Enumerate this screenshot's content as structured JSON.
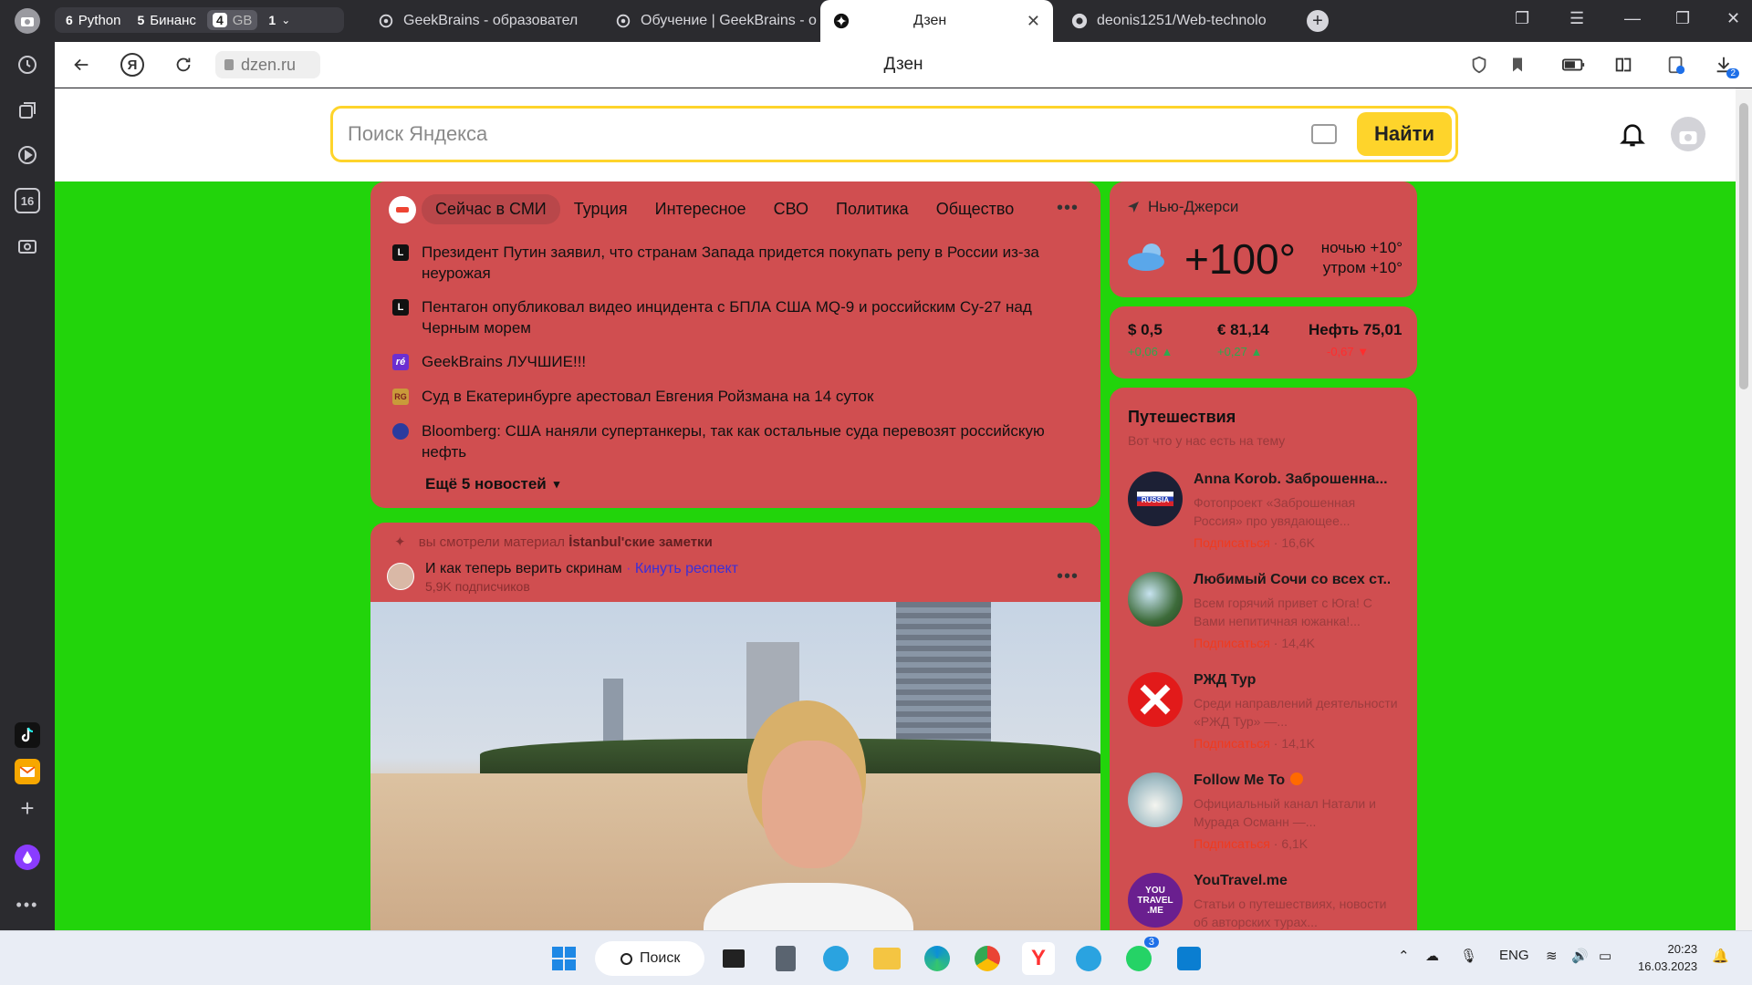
{
  "tabs": {
    "groups": [
      {
        "num": "6",
        "label": "Python"
      },
      {
        "num": "5",
        "label": "Бинанс"
      },
      {
        "num": "4",
        "label": "GB"
      },
      {
        "num": "1",
        "label": ""
      }
    ],
    "items": [
      {
        "title": "GeekBrains - образовател"
      },
      {
        "title": "Обучение | GeekBrains - о"
      },
      {
        "title": "Дзен"
      },
      {
        "title": "deonis1251/Web-technolo"
      }
    ]
  },
  "address": {
    "url": "dzen.ru",
    "page_title": "Дзен"
  },
  "toolbar": {
    "downloads_badge": "2"
  },
  "search": {
    "placeholder": "Поиск Яндекса",
    "button": "Найти"
  },
  "news": {
    "tabs": [
      "Сейчас в СМИ",
      "Турция",
      "Интересное",
      "СВО",
      "Политика",
      "Общество"
    ],
    "items": [
      {
        "src": "L",
        "text": "Президент Путин заявил, что странам Запада придется покупать репу в России из-за неурожая"
      },
      {
        "src": "L",
        "text": "Пентагон опубликовал видео инцидента с БПЛА США MQ-9 и российским Су-27 над Черным морем"
      },
      {
        "src": "ré",
        "text": "GeekBrains ЛУЧШИЕ!!!"
      },
      {
        "src": "RG",
        "text": "Суд в Екатеринбурге арестовал Евгения Ройзмана на 14 суток"
      },
      {
        "src": "",
        "text": "Bloomberg: США наняли супертанкеры, так как остальные суда перевозят российскую нефть"
      }
    ],
    "more": "Ещё 5 новостей"
  },
  "weather": {
    "city": "Нью-Джерси",
    "temp": "+100°",
    "night": "ночью +10°",
    "morning": "утром +10°"
  },
  "rates": [
    {
      "label": "$ 0,5",
      "delta": "+0,06 ▲"
    },
    {
      "label": "€ 81,14",
      "delta": "+0,27 ▲"
    },
    {
      "label": "Нефть 75,01",
      "delta": "-0,67 ▼"
    }
  ],
  "travel": {
    "title": "Путешествия",
    "subtitle": "Вот что у нас есть на тему",
    "subscribe": "Подписаться",
    "channels": [
      {
        "name": "Anna Korob. Заброшенна...",
        "desc": "Фотопроект «Заброшенная Россия» про увядающее...",
        "subs": "16,6K"
      },
      {
        "name": "Любимый Сочи со всех ст...",
        "desc": "Всем горячий привет с Юга! С Вами непитичная южанка!...",
        "subs": "14,4K"
      },
      {
        "name": "РЖД Тур",
        "desc": "Среди направлений деятельности «РЖД Тур» —...",
        "subs": "14,1K"
      },
      {
        "name": "Follow Me To",
        "desc": "Официальный канал Натали и Мурада Османн —...",
        "subs": "6,1K"
      },
      {
        "name": "YouTravel.me",
        "desc": "Статьи о путешествиях, новости об авторских турах..."
      }
    ],
    "avatar_texts": {
      "russia": "RUSSIA",
      "youtravel": "YOU TRAVEL .ME"
    }
  },
  "post": {
    "seen_prefix": "вы смотрели материал",
    "seen_title": "İstanbul'ские заметки",
    "author": "И как теперь верить скринам",
    "action": "Кинуть респект",
    "subscribers": "5,9K подписчиков"
  },
  "taskbar": {
    "search": "Поиск",
    "lang": "ENG",
    "time": "20:23",
    "date": "16.03.2023",
    "telegram_badge": "3"
  },
  "sidebar": {
    "badge": "16"
  }
}
